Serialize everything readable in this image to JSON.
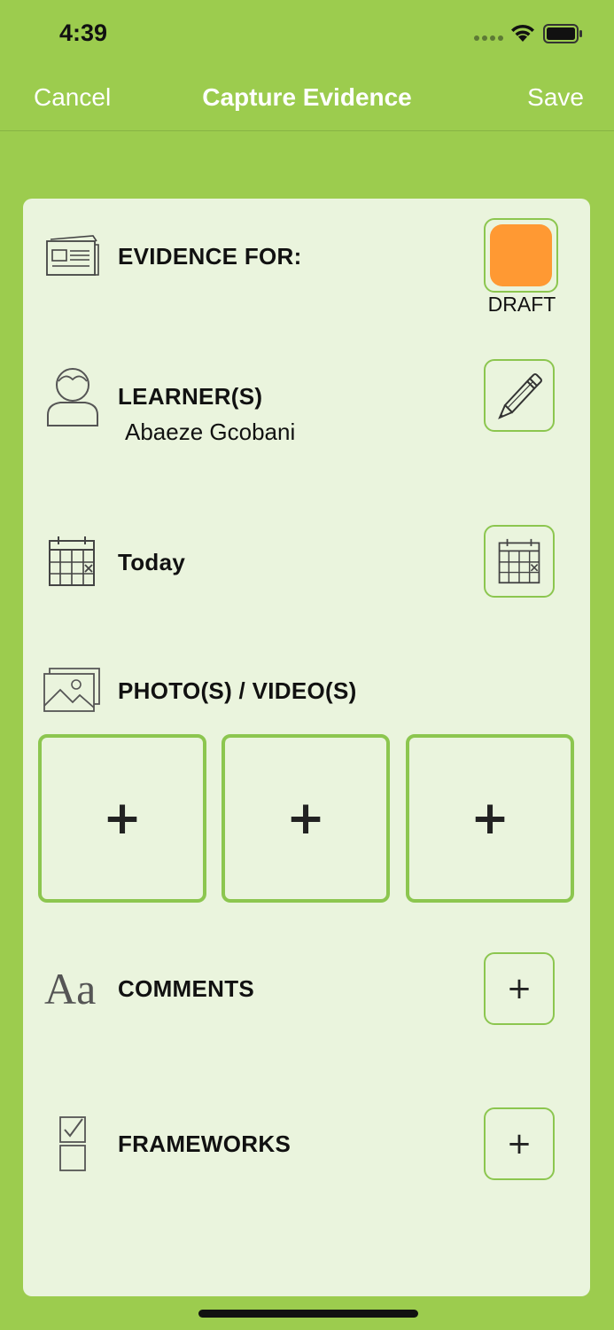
{
  "status_bar": {
    "time": "4:39"
  },
  "nav": {
    "cancel": "Cancel",
    "title": "Capture Evidence",
    "save": "Save"
  },
  "evidence": {
    "label": "EVIDENCE FOR:",
    "status": "DRAFT",
    "status_color": "#ff9933"
  },
  "learners": {
    "label": "LEARNER(S)",
    "value": "Abaeze Gcobani"
  },
  "date": {
    "label": "Today"
  },
  "media": {
    "label": "PHOTO(S) / VIDEO(S)",
    "slot_symbol": "+"
  },
  "comments": {
    "label": "COMMENTS",
    "icon_text": "Aa",
    "add_symbol": "+"
  },
  "frameworks": {
    "label": "FRAMEWORKS",
    "add_symbol": "+"
  },
  "colors": {
    "accent": "#9ccc4e",
    "card": "#eaf4dd",
    "border": "#8cc64f"
  }
}
